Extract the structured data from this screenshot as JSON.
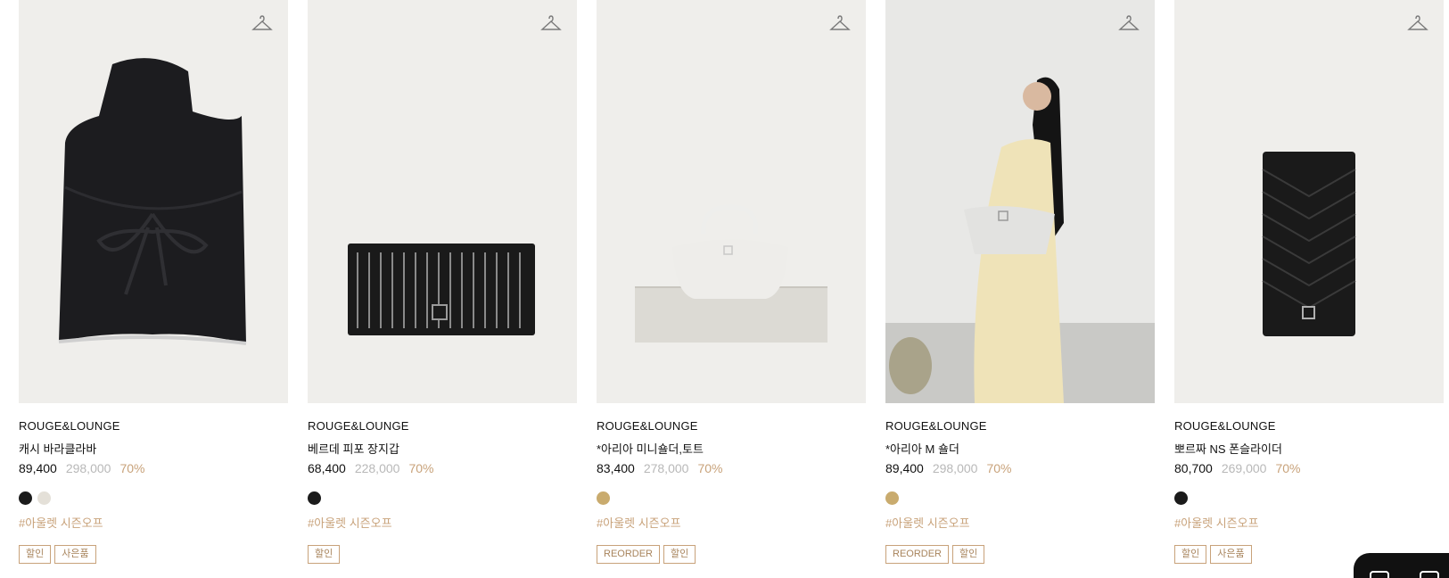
{
  "products": [
    {
      "brand": "ROUGE&LOUNGE",
      "name": "캐시 바라클라바",
      "price": "89,400",
      "original_price": "298,000",
      "discount": "70%",
      "swatches": [
        "#1b1b1b",
        "#e4e0d8"
      ],
      "tagline": "#아울렛 시즌오프",
      "badges": [
        "할인",
        "사은품"
      ],
      "image_icon": "wishlist-hanger-icon"
    },
    {
      "brand": "ROUGE&LOUNGE",
      "name": "베르데 피포 장지갑",
      "price": "68,400",
      "original_price": "228,000",
      "discount": "70%",
      "swatches": [
        "#1b1b1b"
      ],
      "tagline": "#아울렛 시즌오프",
      "badges": [
        "할인"
      ],
      "image_icon": "wishlist-hanger-icon"
    },
    {
      "brand": "ROUGE&LOUNGE",
      "name": "*아리아 미니숄더,토트",
      "price": "83,400",
      "original_price": "278,000",
      "discount": "70%",
      "swatches": [
        "#c9ab6e"
      ],
      "tagline": "#아울렛 시즌오프",
      "badges": [
        "REORDER",
        "할인"
      ],
      "image_icon": "wishlist-hanger-icon"
    },
    {
      "brand": "ROUGE&LOUNGE",
      "name": "*아리아 M 숄더",
      "price": "89,400",
      "original_price": "298,000",
      "discount": "70%",
      "swatches": [
        "#c9ab6e"
      ],
      "tagline": "#아울렛 시즌오프",
      "badges": [
        "REORDER",
        "할인"
      ],
      "image_icon": "wishlist-hanger-icon"
    },
    {
      "brand": "ROUGE&LOUNGE",
      "name": "뽀르짜 NS 폰슬라이더",
      "price": "80,700",
      "original_price": "269,000",
      "discount": "70%",
      "swatches": [
        "#1b1b1b"
      ],
      "tagline": "#아울렛 시즌오프",
      "badges": [
        "할인",
        "사은품"
      ],
      "image_icon": "wishlist-hanger-icon"
    }
  ],
  "colors": {
    "accent": "#c8a27a",
    "image_bg": "#efeeeb",
    "strike": "#b8b8b8"
  }
}
